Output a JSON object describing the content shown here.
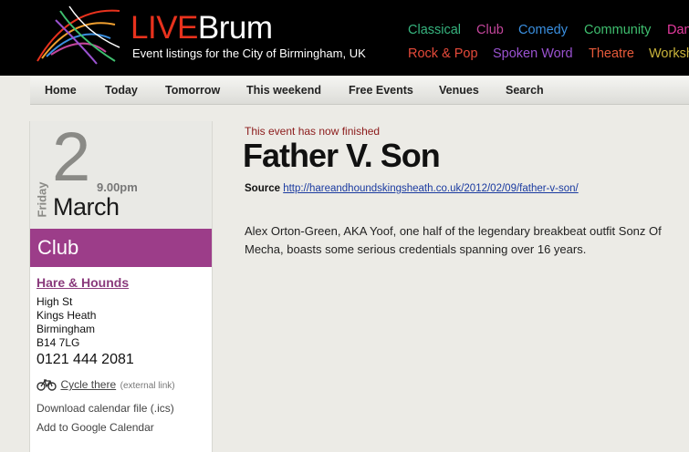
{
  "header": {
    "brand_live": "LIVE",
    "brand_rest": "Brum",
    "tagline": "Event listings for the City of Birmingham, UK",
    "categories": [
      {
        "label": "Classical",
        "color": "#36b37e"
      },
      {
        "label": "Club",
        "color": "#c2459a"
      },
      {
        "label": "Comedy",
        "color": "#3a8fe0"
      },
      {
        "label": "Community",
        "color": "#3fbf6f"
      },
      {
        "label": "Dance",
        "color": "#e63aa0"
      },
      {
        "label": "Rock & Pop",
        "color": "#e64a3a"
      },
      {
        "label": "Spoken Word",
        "color": "#9a52d0"
      },
      {
        "label": "Theatre",
        "color": "#e65a3a"
      },
      {
        "label": "Workshops",
        "color": "#c8b23a"
      }
    ]
  },
  "nav": [
    "Home",
    "Today",
    "Tomorrow",
    "This weekend",
    "Free Events",
    "Venues",
    "Search"
  ],
  "event": {
    "day_number": "2",
    "weekday": "Friday",
    "time": "9.00pm",
    "month": "March",
    "category": "Club",
    "category_color": "#9c3d89",
    "status": "This event has now finished",
    "title": "Father V. Son",
    "source_label": "Source",
    "source_url": "http://hareandhoundskingsheath.co.uk/2012/02/09/father-v-son/",
    "description": "Alex Orton-Green, AKA Yoof, one half of the legendary breakbeat outfit Sonz Of Mecha, boasts some serious credentials spanning over 16 years."
  },
  "venue": {
    "name": "Hare & Hounds",
    "address": [
      "High St",
      "Kings Heath",
      "Birmingham",
      "B14 7LG"
    ],
    "phone": "0121 444 2081",
    "cycle_label": "Cycle there",
    "cycle_note": "(external link)",
    "download_ics": "Download calendar file (.ics)",
    "google_cal": "Add to Google Calendar"
  }
}
